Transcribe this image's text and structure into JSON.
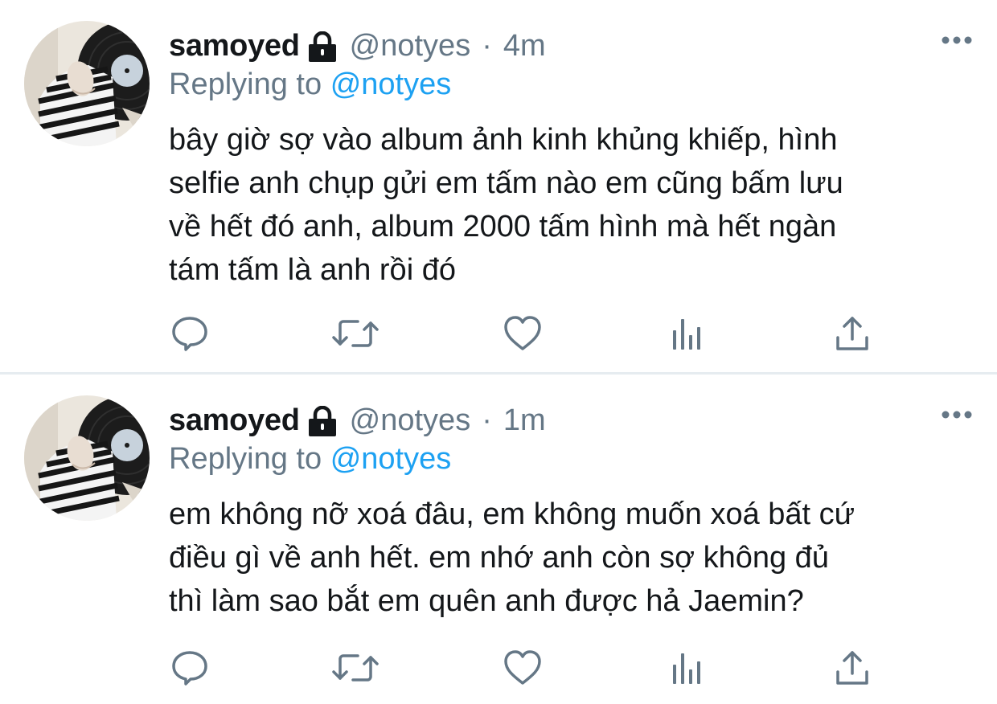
{
  "tweets": [
    {
      "display_name": "samoyed",
      "handle": "@notyes",
      "separator": "·",
      "time": "4m",
      "replying_prefix": "Replying to",
      "replying_to": "@notyes",
      "text": "bây giờ sợ vào album ảnh kinh khủng khiếp, hình\nselfie anh chụp gửi em tấm nào em cũng bấm lưu\nvề hết đó anh, album 2000 tấm hình mà hết ngàn\ntám tấm là anh rồi đó",
      "icons": [
        "lock-icon",
        "more-icon",
        "reply-icon",
        "retweet-icon",
        "like-icon",
        "analytics-icon",
        "share-icon"
      ]
    },
    {
      "display_name": "samoyed",
      "handle": "@notyes",
      "separator": "·",
      "time": "1m",
      "replying_prefix": "Replying to",
      "replying_to": "@notyes",
      "text": "em không nỡ xoá đâu, em không muốn xoá bất cứ\nđiều gì về anh hết. em nhớ anh còn sợ không đủ\nthì làm sao bắt em quên anh được hả Jaemin?",
      "icons": [
        "lock-icon",
        "more-icon",
        "reply-icon",
        "retweet-icon",
        "like-icon",
        "analytics-icon",
        "share-icon"
      ]
    }
  ],
  "colors": {
    "text": "#14171a",
    "secondary": "#657786",
    "link": "#1da1f2",
    "divider": "#e6ecf0"
  }
}
